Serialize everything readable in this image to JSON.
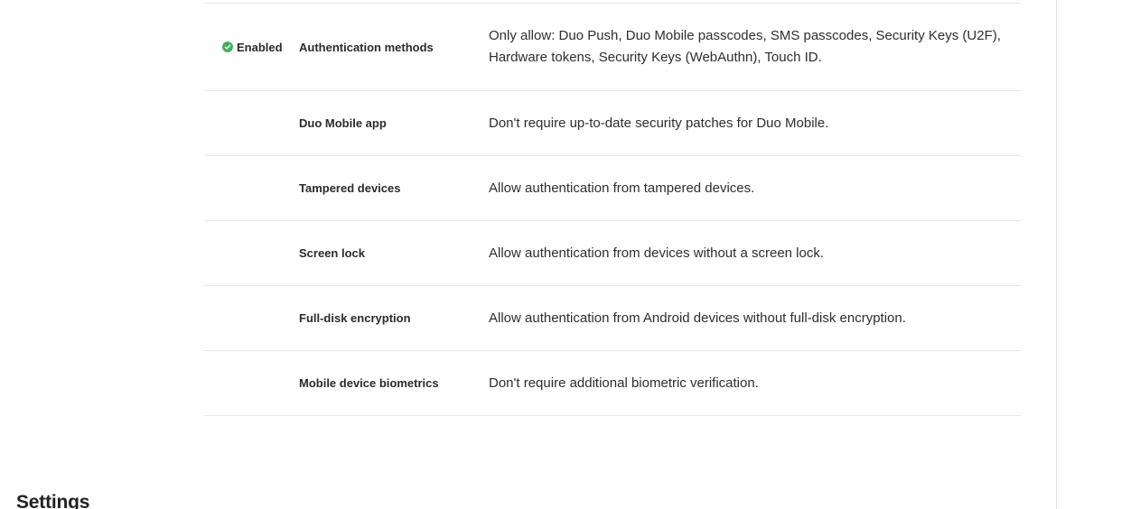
{
  "policies": [
    {
      "status": "Enabled",
      "name": "Authentication methods",
      "description": "Only allow: Duo Push, Duo Mobile passcodes, SMS passcodes, Security Keys (U2F), Hardware tokens, Security Keys (WebAuthn), Touch ID."
    },
    {
      "name": "Duo Mobile app",
      "description": "Don't require up-to-date security patches for Duo Mobile."
    },
    {
      "name": "Tampered devices",
      "description": "Allow authentication from tampered devices."
    },
    {
      "name": "Screen lock",
      "description": "Allow authentication from devices without a screen lock."
    },
    {
      "name": "Full-disk encryption",
      "description": "Allow authentication from Android devices without full-disk encryption."
    },
    {
      "name": "Mobile device biometrics",
      "description": "Don't require additional biometric verification."
    }
  ],
  "settings_section": {
    "title": "Settings"
  },
  "colors": {
    "enabled_icon": "#3fb15e",
    "divider": "#e6e6e6"
  },
  "icons": {
    "enabled": "check-circle-icon"
  }
}
